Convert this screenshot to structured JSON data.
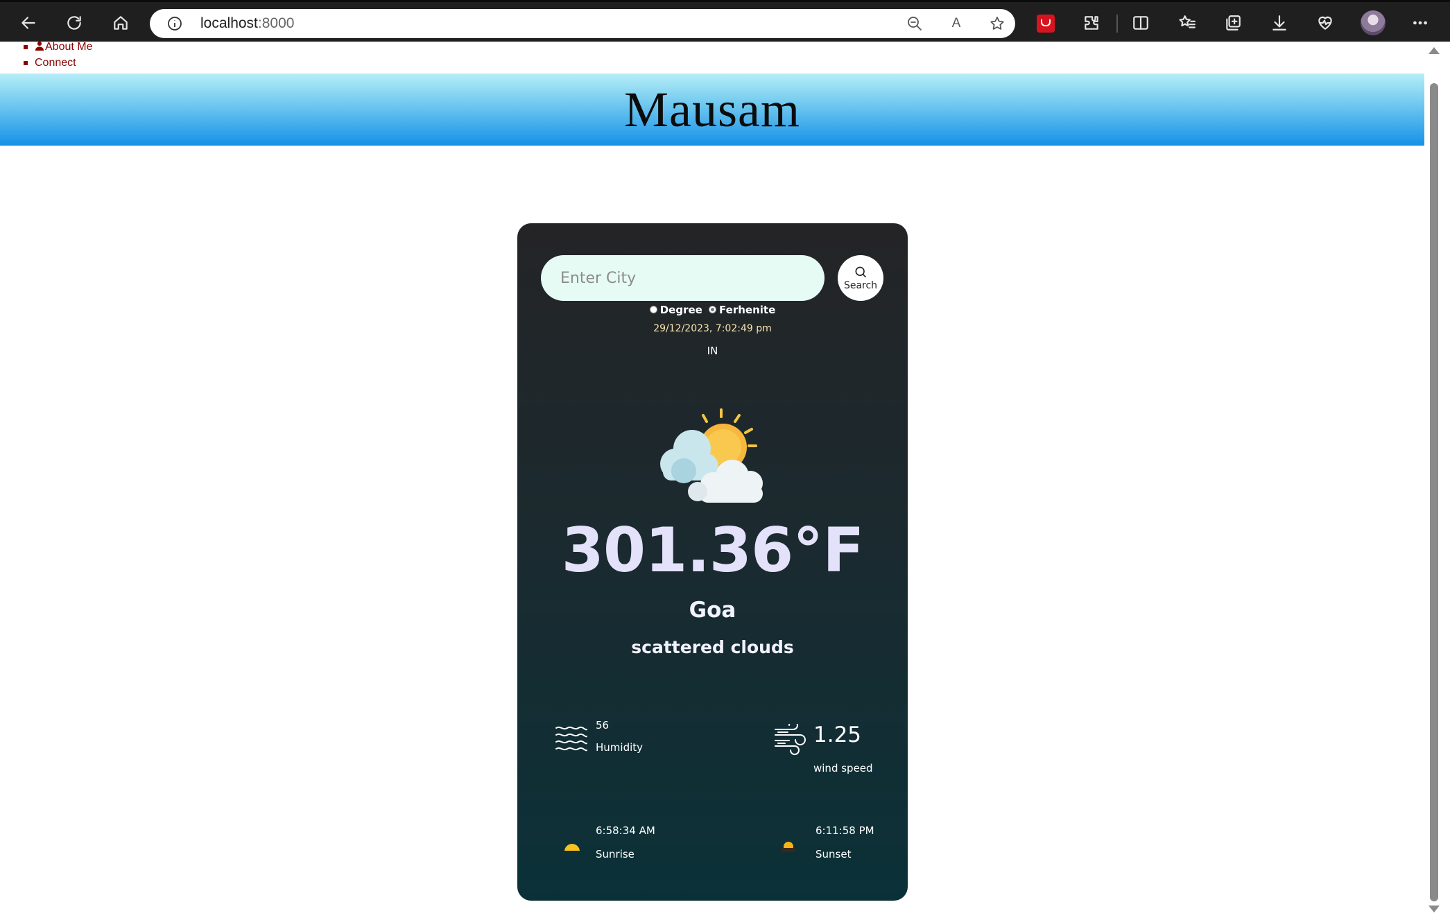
{
  "browser": {
    "url_host": "localhost",
    "url_port": ":8000",
    "read_aloud": "A"
  },
  "nav": {
    "items": [
      {
        "label": "About Me"
      },
      {
        "label": "Connect"
      }
    ]
  },
  "header": {
    "title": "Mausam"
  },
  "weather": {
    "search_placeholder": "Enter City",
    "search_button": "Search",
    "unit_options": [
      {
        "label": "Degree",
        "checked": false
      },
      {
        "label": "Ferhenite",
        "checked": true
      }
    ],
    "datetime": "29/12/2023, 7:02:49 pm",
    "country": "IN",
    "icon": "partly-cloudy-icon",
    "temperature": "301.36°F",
    "city": "Goa",
    "description": "scattered clouds",
    "humidity": {
      "value": "56",
      "label": "Humidity"
    },
    "wind": {
      "value": "1.25",
      "label": "wind speed"
    },
    "sunrise": {
      "time": "6:58:34 AM",
      "label": "Sunrise"
    },
    "sunset": {
      "time": "6:11:58 PM",
      "label": "Sunset"
    }
  },
  "colors": {
    "nav_link": "#8b0000",
    "banner_top": "#b6eef7",
    "banner_bottom": "#1591e8",
    "card_top": "#242426",
    "card_bottom": "#0b3138",
    "temperature_text": "#e4e2fb",
    "datetime_text": "#f7e3b0"
  }
}
